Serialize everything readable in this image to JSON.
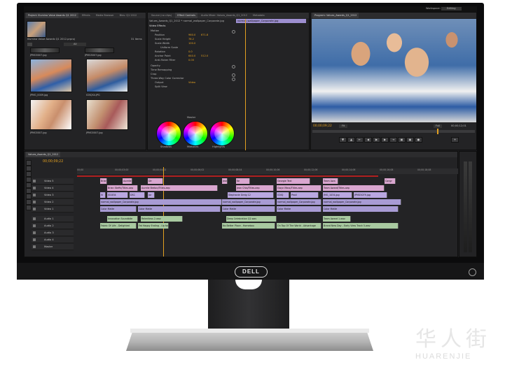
{
  "app": {
    "workspace_label": "Workspace:",
    "workspace_value": "Editing"
  },
  "project_panel": {
    "tabs": [
      "Project: Illumina Value Awards Q1 2012",
      "Effects",
      "Media Browser",
      "Bins: Q1 2012"
    ],
    "project_name": "Illumina Value Awards Q1 2012.prproj",
    "item_count": "31 Items",
    "filter_value": "All",
    "thumbnails": [
      {
        "label": "JPMG5007.jpg"
      },
      {
        "label": "JPMG5007.jpg"
      },
      {
        "label": "JPMG_0009.jpg"
      },
      {
        "label": "ICNQS4.JPG"
      },
      {
        "label": "JPMG5007.jpg"
      },
      {
        "label": "JPMG5007.jpg"
      }
    ]
  },
  "effect_controls": {
    "tabs": [
      "Source (no clips)",
      "Effect Controls",
      "Audio Mixer: Values_Awards_Q1_2012",
      "Metadata"
    ],
    "clip_name": "Values_Awards_Q1_2012 * normal_wallpaper_Corporate.jpg",
    "timeline_clip": "normal_wallpaper_Corporate.jpg",
    "section": "Video Effects",
    "rows": [
      {
        "label": "Motion",
        "value": ""
      },
      {
        "label": "Position",
        "value": "960.0",
        "value2": "671.8"
      },
      {
        "label": "Scale Height",
        "value": "78.2",
        "value2": ""
      },
      {
        "label": "Scale Width",
        "value": "100.0",
        "value2": ""
      },
      {
        "label": "Uniform Scale",
        "value": "",
        "value2": ""
      },
      {
        "label": "Rotation",
        "value": "0.0",
        "value2": ""
      },
      {
        "label": "Anchor Point",
        "value": "640.0",
        "value2": "512.0"
      },
      {
        "label": "Anti-flicker Filter",
        "value": "0.00",
        "value2": ""
      },
      {
        "label": "Opacity",
        "value": "",
        "value2": ""
      },
      {
        "label": "Time Remapping",
        "value": "",
        "value2": ""
      },
      {
        "label": "Crop",
        "value": "",
        "value2": ""
      },
      {
        "label": "Three-Way Color Corrector",
        "value": "",
        "value2": ""
      },
      {
        "label": "Output",
        "value": "Video",
        "value2": ""
      },
      {
        "label": "Split View",
        "value": "",
        "value2": ""
      }
    ],
    "master_label": "Master",
    "wheel_labels": [
      "Shadows",
      "Midtones",
      "Highlights"
    ]
  },
  "program_monitor": {
    "tabs": [
      "Program: Values_Awards_Q1_2012"
    ],
    "timecode": "00;00;09;22",
    "fit_label": "Fit",
    "full_label": "Full",
    "duration": "00;00;12;01"
  },
  "timeline": {
    "tab": "Values_Awards_Q1_2012",
    "timecode": "00;00;09;22",
    "ruler": [
      "00;00",
      "00;00;03;00",
      "00;00;04;02",
      "00;00;06;02",
      "00;00;08;04",
      "00;00;10;06",
      "00;00;12;06",
      "00;00;14;06",
      "00;00;16;08",
      "00;00;18;08"
    ],
    "tracks": [
      {
        "name": "Video 5"
      },
      {
        "name": "Video 4"
      },
      {
        "name": "Video 3"
      },
      {
        "name": "Video 2"
      },
      {
        "name": "Video 1"
      },
      {
        "name": "Audio 1"
      },
      {
        "name": "Audio 2"
      },
      {
        "name": "Audio 3"
      },
      {
        "name": "Audio 4"
      },
      {
        "name": "Master"
      }
    ],
    "clips": {
      "v5": [
        "Brian",
        "Aurelie",
        "Dir",
        "Jean Tou",
        "Ke",
        "Georgie Text",
        "Team Awa",
        "Congr"
      ],
      "v4": [
        "Brian Steffs/Titles.aep",
        "Aurelie Breton/Titles.aep",
        "Jean Chia/Titles.aep",
        "Gwyn Mass/Titles.aep",
        "Team Award/Titles.aep"
      ],
      "v3": [
        "IV",
        "JSC634",
        "DSC",
        "Jor",
        "Stephanie Greig 12",
        "ICNQ",
        "Peoil",
        "JMG_1034.jpg",
        "JPMG5079.jpg"
      ],
      "v2": [
        "normal_wallpaper_Corporate.jpg",
        "normal_wallpaper_Corporate.jpg",
        "normal_wallpaper_Corporate.jpg",
        "normal_wallpaper_Corporate.jpg"
      ],
      "v1": [
        "Color Matte",
        "Color Matte",
        "Color Matte",
        "Color Matte",
        "Color Matte"
      ],
      "a1": [
        "Innovation Soundbite",
        "Relentless 2.wav",
        "Deep Celebration Q2.wav",
        "Team Award 1.wav"
      ],
      "a2": [
        "Fabric Of Life - Delighted",
        "Fat Happy Ending - Up for",
        "No Better Place - Homebou",
        "On Top Of The World - Advantage",
        "Brand New Day - Early View Track 5.wav"
      ]
    }
  },
  "monitor": {
    "brand": "DELL"
  },
  "watermark": {
    "cn": "华人街",
    "en": "HUARENJIE"
  },
  "colors": {
    "accent": "#e3a020",
    "panel": "#232325",
    "clip_pink": "#d9a6cf",
    "clip_purple": "#a89bd4",
    "clip_green": "#a8c9a0"
  }
}
